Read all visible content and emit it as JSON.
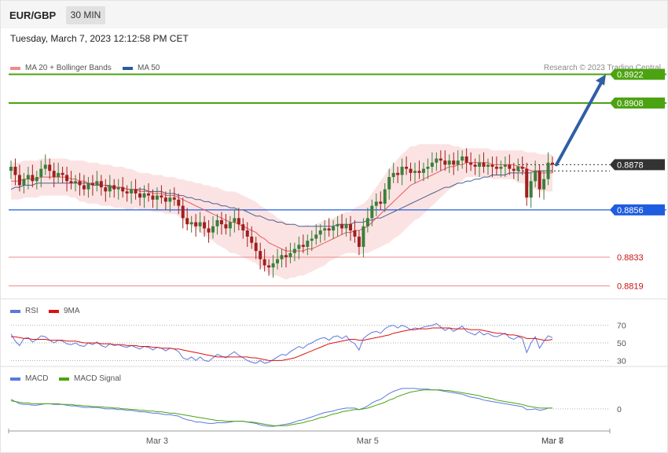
{
  "header": {
    "pair": "EUR/GBP",
    "timeframe": "30 MIN"
  },
  "timestamp": "Tuesday, March 7, 2023 12:12:58 PM CET",
  "copyright": "Research © 2023 Trading Central",
  "colors": {
    "up": "#3b7f3b",
    "down": "#a01f1f",
    "ma20": "#e85a5a",
    "ma50": "#4a5f8f",
    "band": "#fbd9d9",
    "resistance": "#4ca312",
    "pivot": "#1f5de0",
    "support": "#f08a8a",
    "support_label": "#cc1111",
    "arrow": "#2f5fa5",
    "last": "#333333",
    "rsi": "#5b78e0",
    "rsi9": "#dd1111",
    "macd": "#5b78e0",
    "signal": "#4ca312"
  },
  "chart_data": [
    {
      "type": "candlestick",
      "panel": "price",
      "legend": [
        {
          "name": "MA 20 + Bollinger Bands",
          "color": "#f08a8a"
        },
        {
          "name": "MA 50",
          "color": "#2c5aa0"
        }
      ],
      "x_tick_labels": [
        "Mar 3",
        "Mar 5",
        "Mar 7",
        "Mar 8"
      ],
      "ylim": [
        0.8815,
        0.8926
      ],
      "levels": [
        {
          "value": 0.8922,
          "label": "0.8922",
          "kind": "resistance"
        },
        {
          "value": 0.8908,
          "label": "0.8908",
          "kind": "resistance"
        },
        {
          "value": 0.8878,
          "label": "0.8878",
          "kind": "last"
        },
        {
          "value": 0.8856,
          "label": "0.8856",
          "kind": "pivot"
        },
        {
          "value": 0.8833,
          "label": "0.8833",
          "kind": "support"
        },
        {
          "value": 0.8819,
          "label": "0.8819",
          "kind": "support"
        }
      ],
      "close": [
        0.8877,
        0.8873,
        0.8868,
        0.8871,
        0.8873,
        0.887,
        0.8872,
        0.8876,
        0.8878,
        0.8875,
        0.8872,
        0.8874,
        0.8873,
        0.887,
        0.8869,
        0.887,
        0.8868,
        0.8866,
        0.8869,
        0.8868,
        0.887,
        0.8867,
        0.8865,
        0.8868,
        0.8866,
        0.8867,
        0.8865,
        0.8864,
        0.8866,
        0.8864,
        0.8862,
        0.8864,
        0.8863,
        0.8861,
        0.8863,
        0.8862,
        0.886,
        0.8862,
        0.8861,
        0.8858,
        0.8852,
        0.8849,
        0.885,
        0.8848,
        0.885,
        0.8847,
        0.8845,
        0.8848,
        0.8851,
        0.8849,
        0.8847,
        0.885,
        0.8852,
        0.8849,
        0.8846,
        0.8843,
        0.884,
        0.8836,
        0.8832,
        0.8829,
        0.8828,
        0.883,
        0.8832,
        0.8834,
        0.8833,
        0.8835,
        0.8837,
        0.8839,
        0.8838,
        0.8841,
        0.8842,
        0.8844,
        0.8846,
        0.8847,
        0.8846,
        0.8848,
        0.8849,
        0.8847,
        0.8849,
        0.8846,
        0.8843,
        0.8838,
        0.8848,
        0.8852,
        0.8858,
        0.886,
        0.8859,
        0.8866,
        0.8872,
        0.8874,
        0.8873,
        0.8877,
        0.8876,
        0.8874,
        0.8875,
        0.8874,
        0.8876,
        0.8877,
        0.8879,
        0.8881,
        0.888,
        0.8878,
        0.888,
        0.8878,
        0.888,
        0.8882,
        0.8879,
        0.8878,
        0.8877,
        0.8879,
        0.8877,
        0.8878,
        0.8877,
        0.8876,
        0.8877,
        0.8878,
        0.8876,
        0.8875,
        0.8877,
        0.8876,
        0.8862,
        0.887,
        0.8875,
        0.8866,
        0.8871,
        0.8879,
        0.8878
      ],
      "ma20": [
        0.887,
        0.887,
        0.887,
        0.8871,
        0.8871,
        0.8871,
        0.8871,
        0.8872,
        0.8872,
        0.8872,
        0.8872,
        0.8872,
        0.8872,
        0.8872,
        0.8871,
        0.8871,
        0.887,
        0.887,
        0.8869,
        0.8869,
        0.8869,
        0.8868,
        0.8868,
        0.8868,
        0.8867,
        0.8867,
        0.8867,
        0.8866,
        0.8866,
        0.8866,
        0.8865,
        0.8865,
        0.8865,
        0.8864,
        0.8864,
        0.8864,
        0.8863,
        0.8863,
        0.8863,
        0.8862,
        0.8861,
        0.886,
        0.8859,
        0.8858,
        0.8857,
        0.8856,
        0.8855,
        0.8854,
        0.8853,
        0.8852,
        0.8851,
        0.885,
        0.885,
        0.8849,
        0.8848,
        0.8847,
        0.8846,
        0.8845,
        0.8843,
        0.8842,
        0.884,
        0.8839,
        0.8838,
        0.8837,
        0.8836,
        0.8836,
        0.8836,
        0.8836,
        0.8836,
        0.8837,
        0.8837,
        0.8838,
        0.8839,
        0.884,
        0.8841,
        0.8842,
        0.8843,
        0.8844,
        0.8845,
        0.8845,
        0.8846,
        0.8846,
        0.8847,
        0.8848,
        0.885,
        0.8852,
        0.8854,
        0.8856,
        0.8858,
        0.886,
        0.8862,
        0.8864,
        0.8866,
        0.8868,
        0.8869,
        0.887,
        0.8871,
        0.8872,
        0.8873,
        0.8874,
        0.8875,
        0.8876,
        0.8877,
        0.8877,
        0.8878,
        0.8878,
        0.8879,
        0.8879,
        0.8879,
        0.8879,
        0.8879,
        0.8879,
        0.8878,
        0.8878,
        0.8878,
        0.8878,
        0.8878,
        0.8878,
        0.8877,
        0.8877,
        0.8876,
        0.8875,
        0.8875,
        0.8874,
        0.8874,
        0.8874,
        0.8874
      ],
      "ma50": [
        0.8866,
        0.8867,
        0.8867,
        0.8868,
        0.8868,
        0.8868,
        0.8869,
        0.8869,
        0.8869,
        0.8869,
        0.8869,
        0.8869,
        0.8869,
        0.8869,
        0.8869,
        0.8869,
        0.8869,
        0.8869,
        0.8869,
        0.8868,
        0.8868,
        0.8868,
        0.8868,
        0.8867,
        0.8867,
        0.8867,
        0.8867,
        0.8866,
        0.8866,
        0.8866,
        0.8866,
        0.8866,
        0.8865,
        0.8865,
        0.8865,
        0.8865,
        0.8864,
        0.8864,
        0.8864,
        0.8863,
        0.8863,
        0.8862,
        0.8862,
        0.8861,
        0.8861,
        0.886,
        0.886,
        0.8859,
        0.8859,
        0.8858,
        0.8858,
        0.8857,
        0.8857,
        0.8856,
        0.8856,
        0.8855,
        0.8854,
        0.8853,
        0.8853,
        0.8852,
        0.8851,
        0.8851,
        0.885,
        0.885,
        0.8849,
        0.8849,
        0.8849,
        0.8848,
        0.8848,
        0.8848,
        0.8848,
        0.8848,
        0.8848,
        0.8848,
        0.8848,
        0.8848,
        0.8849,
        0.8849,
        0.8849,
        0.8849,
        0.885,
        0.885,
        0.885,
        0.8851,
        0.8851,
        0.8852,
        0.8852,
        0.8853,
        0.8854,
        0.8855,
        0.8856,
        0.8857,
        0.8858,
        0.8859,
        0.886,
        0.8861,
        0.8862,
        0.8863,
        0.8864,
        0.8865,
        0.8866,
        0.8867,
        0.8867,
        0.8868,
        0.8869,
        0.8869,
        0.887,
        0.887,
        0.8871,
        0.8871,
        0.8872,
        0.8872,
        0.8873,
        0.8873,
        0.8873,
        0.8873,
        0.8874,
        0.8874,
        0.8874,
        0.8874,
        0.8874,
        0.8874,
        0.8875,
        0.8875,
        0.8875,
        0.8875,
        0.8875
      ],
      "band_width": [
        0.0009,
        0.0009,
        0.0009,
        0.0009,
        0.0009,
        0.0009,
        0.0009,
        0.0009,
        0.0009,
        0.0009,
        0.0009,
        0.0009,
        0.0009,
        0.0009,
        0.0009,
        0.0009,
        0.001,
        0.001,
        0.001,
        0.001,
        0.001,
        0.001,
        0.001,
        0.001,
        0.001,
        0.001,
        0.001,
        0.001,
        0.001,
        0.0009,
        0.0009,
        0.0009,
        0.0009,
        0.0009,
        0.0009,
        0.0009,
        0.0009,
        0.0009,
        0.0009,
        0.0009,
        0.001,
        0.001,
        0.0011,
        0.0011,
        0.0012,
        0.0012,
        0.0013,
        0.0013,
        0.0014,
        0.0014,
        0.0014,
        0.0015,
        0.0015,
        0.0015,
        0.0015,
        0.0015,
        0.0015,
        0.0015,
        0.0015,
        0.0015,
        0.0015,
        0.0015,
        0.0014,
        0.0014,
        0.0014,
        0.0013,
        0.0013,
        0.0012,
        0.0012,
        0.0012,
        0.0011,
        0.0011,
        0.0011,
        0.0011,
        0.001,
        0.001,
        0.001,
        0.001,
        0.001,
        0.001,
        0.0011,
        0.0012,
        0.0012,
        0.0013,
        0.0014,
        0.0015,
        0.0016,
        0.0017,
        0.0018,
        0.0018,
        0.0019,
        0.0019,
        0.0019,
        0.0019,
        0.0018,
        0.0018,
        0.0017,
        0.0016,
        0.0015,
        0.0014,
        0.0013,
        0.0012,
        0.0011,
        0.001,
        0.0009,
        0.0008,
        0.0007,
        0.0007,
        0.0007,
        0.0007,
        0.0007,
        0.0007,
        0.0007,
        0.0007,
        0.0007,
        0.0007,
        0.0007,
        0.0007,
        0.0008,
        0.0008,
        0.0008,
        0.0009,
        0.0009,
        0.0009,
        0.0009,
        0.0009,
        0.0009
      ],
      "projection": {
        "from": 0.8878,
        "to": 0.8922
      }
    },
    {
      "type": "line",
      "panel": "rsi",
      "legend": [
        {
          "name": "RSI",
          "color": "#5b78e0"
        },
        {
          "name": "9MA",
          "color": "#dd1111"
        }
      ],
      "y_ticks": [
        70,
        50,
        30
      ],
      "ylim": [
        25,
        75
      ],
      "series": [
        {
          "name": "RSI",
          "values": [
            60,
            52,
            47,
            55,
            56,
            51,
            54,
            58,
            57,
            53,
            50,
            53,
            52,
            49,
            48,
            50,
            47,
            46,
            50,
            48,
            51,
            47,
            45,
            49,
            47,
            48,
            46,
            45,
            47,
            45,
            43,
            46,
            45,
            42,
            45,
            44,
            41,
            44,
            43,
            40,
            33,
            31,
            34,
            30,
            34,
            30,
            29,
            33,
            37,
            35,
            33,
            37,
            40,
            36,
            33,
            30,
            28,
            27,
            30,
            27,
            28,
            31,
            34,
            37,
            36,
            40,
            43,
            46,
            44,
            48,
            50,
            53,
            55,
            56,
            53,
            57,
            58,
            55,
            58,
            52,
            49,
            42,
            55,
            59,
            62,
            63,
            61,
            66,
            69,
            70,
            67,
            70,
            68,
            65,
            67,
            66,
            68,
            69,
            70,
            72,
            68,
            64,
            67,
            63,
            66,
            69,
            63,
            61,
            59,
            63,
            59,
            61,
            58,
            57,
            59,
            61,
            56,
            54,
            57,
            55,
            39,
            50,
            57,
            44,
            52,
            58,
            56
          ]
        },
        {
          "name": "9MA",
          "values": [
            57,
            57,
            56,
            55,
            55,
            54,
            54,
            54,
            54,
            53,
            53,
            53,
            53,
            52,
            52,
            52,
            51,
            50,
            50,
            50,
            50,
            49,
            49,
            49,
            48,
            48,
            48,
            47,
            47,
            47,
            46,
            46,
            46,
            45,
            45,
            44,
            44,
            44,
            43,
            43,
            42,
            41,
            40,
            39,
            38,
            37,
            36,
            35,
            34,
            34,
            34,
            34,
            34,
            34,
            34,
            34,
            33,
            33,
            32,
            31,
            30,
            30,
            30,
            30,
            31,
            32,
            33,
            35,
            37,
            39,
            41,
            43,
            45,
            47,
            49,
            50,
            51,
            52,
            53,
            54,
            54,
            53,
            53,
            54,
            55,
            56,
            57,
            58,
            59,
            61,
            62,
            63,
            64,
            65,
            65,
            66,
            66,
            66,
            67,
            67,
            67,
            67,
            67,
            66,
            66,
            66,
            66,
            65,
            65,
            65,
            64,
            63,
            62,
            61,
            61,
            60,
            59,
            59,
            58,
            57,
            55,
            55,
            55,
            54,
            53,
            53,
            54
          ]
        }
      ]
    },
    {
      "type": "line",
      "panel": "macd",
      "legend": [
        {
          "name": "MACD",
          "color": "#5b78e0"
        },
        {
          "name": "MACD Signal",
          "color": "#4ca312"
        }
      ],
      "y_ticks": [
        0
      ],
      "ylim": [
        -2.6,
        3.0
      ],
      "series": [
        {
          "name": "MACD",
          "values": [
            1.3,
            1.0,
            0.7,
            0.6,
            0.6,
            0.5,
            0.5,
            0.6,
            0.7,
            0.7,
            0.6,
            0.6,
            0.6,
            0.5,
            0.4,
            0.4,
            0.3,
            0.2,
            0.2,
            0.2,
            0.2,
            0.1,
            0.0,
            0.0,
            0.0,
            -0.1,
            -0.1,
            -0.2,
            -0.2,
            -0.3,
            -0.4,
            -0.4,
            -0.5,
            -0.6,
            -0.6,
            -0.7,
            -0.8,
            -0.8,
            -0.9,
            -1.0,
            -1.3,
            -1.5,
            -1.6,
            -1.8,
            -1.8,
            -1.9,
            -2.0,
            -2.0,
            -1.9,
            -1.9,
            -1.9,
            -1.8,
            -1.7,
            -1.7,
            -1.7,
            -1.8,
            -1.9,
            -2.0,
            -2.2,
            -2.3,
            -2.4,
            -2.4,
            -2.3,
            -2.2,
            -2.1,
            -2.0,
            -1.8,
            -1.6,
            -1.5,
            -1.3,
            -1.1,
            -0.9,
            -0.7,
            -0.5,
            -0.4,
            -0.3,
            -0.1,
            0.0,
            0.1,
            0.1,
            0.1,
            -0.1,
            0.1,
            0.4,
            0.8,
            1.1,
            1.3,
            1.7,
            2.1,
            2.4,
            2.6,
            2.8,
            2.8,
            2.8,
            2.8,
            2.7,
            2.7,
            2.7,
            2.6,
            2.6,
            2.5,
            2.4,
            2.3,
            2.2,
            2.1,
            2.0,
            1.8,
            1.6,
            1.5,
            1.4,
            1.2,
            1.1,
            1.0,
            0.9,
            0.8,
            0.7,
            0.6,
            0.5,
            0.4,
            0.3,
            -0.1,
            -0.1,
            0.0,
            -0.2,
            -0.1,
            0.1,
            0.1
          ]
        },
        {
          "name": "MACD Signal",
          "values": [
            1.1,
            1.0,
            0.9,
            0.8,
            0.8,
            0.7,
            0.7,
            0.7,
            0.7,
            0.7,
            0.7,
            0.7,
            0.6,
            0.6,
            0.6,
            0.5,
            0.5,
            0.4,
            0.4,
            0.3,
            0.3,
            0.3,
            0.2,
            0.2,
            0.1,
            0.1,
            0.0,
            0.0,
            -0.1,
            -0.1,
            -0.2,
            -0.2,
            -0.3,
            -0.3,
            -0.4,
            -0.4,
            -0.5,
            -0.6,
            -0.6,
            -0.7,
            -0.8,
            -0.9,
            -1.0,
            -1.1,
            -1.2,
            -1.3,
            -1.4,
            -1.5,
            -1.6,
            -1.6,
            -1.7,
            -1.7,
            -1.7,
            -1.7,
            -1.7,
            -1.8,
            -1.8,
            -1.9,
            -2.0,
            -2.1,
            -2.2,
            -2.3,
            -2.3,
            -2.3,
            -2.3,
            -2.2,
            -2.1,
            -2.0,
            -1.9,
            -1.7,
            -1.6,
            -1.4,
            -1.2,
            -1.1,
            -0.9,
            -0.7,
            -0.6,
            -0.4,
            -0.3,
            -0.2,
            -0.1,
            -0.1,
            0.0,
            0.1,
            0.3,
            0.5,
            0.7,
            0.9,
            1.2,
            1.4,
            1.7,
            1.9,
            2.1,
            2.3,
            2.4,
            2.5,
            2.6,
            2.6,
            2.6,
            2.6,
            2.6,
            2.5,
            2.5,
            2.4,
            2.3,
            2.2,
            2.1,
            2.0,
            1.9,
            1.8,
            1.6,
            1.5,
            1.4,
            1.2,
            1.1,
            1.0,
            0.9,
            0.8,
            0.7,
            0.6,
            0.4,
            0.3,
            0.2,
            0.1,
            0.1,
            0.1,
            0.1
          ]
        }
      ]
    }
  ]
}
